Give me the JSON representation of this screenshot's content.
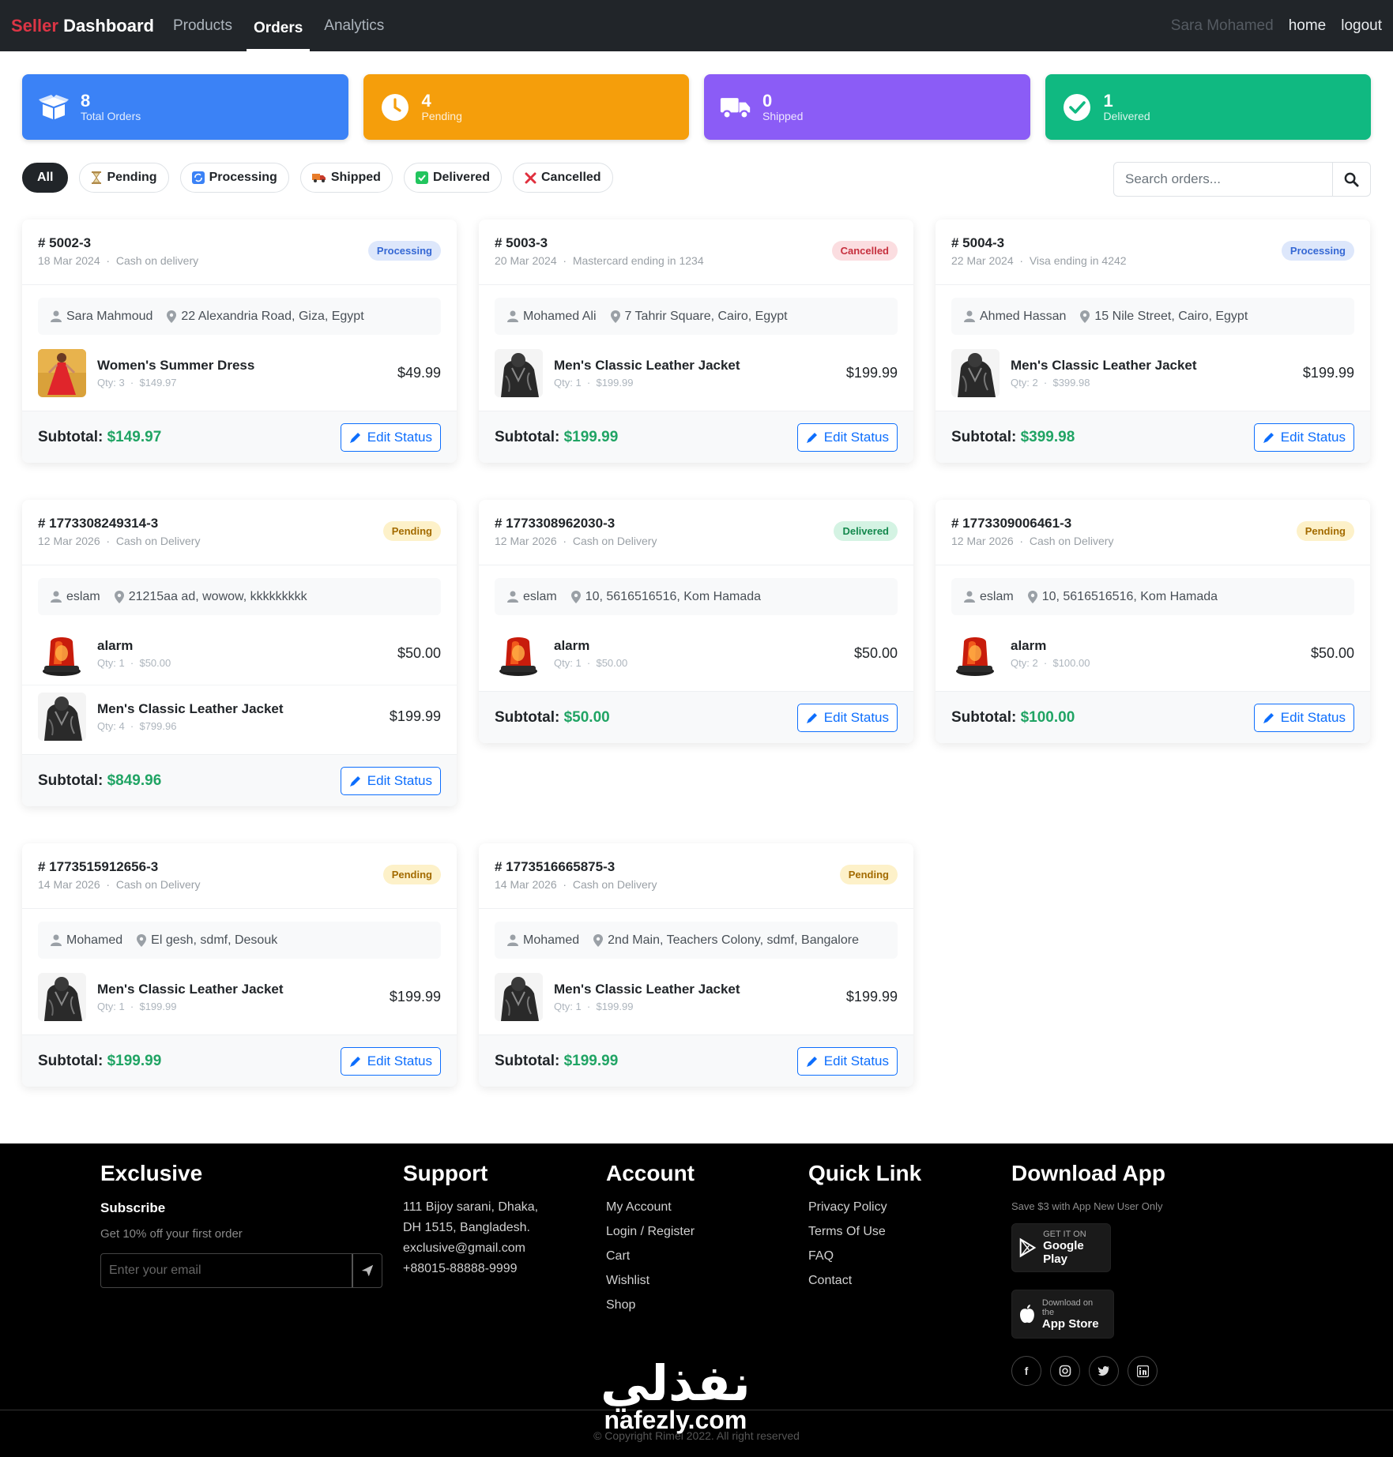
{
  "nav": {
    "brand_accent": "Seller",
    "brand_rest": "Dashboard",
    "links": [
      "Products",
      "Orders",
      "Analytics"
    ],
    "active": "Orders",
    "user": "Sara Mohamed",
    "home": "home",
    "logout": "logout"
  },
  "stats": [
    {
      "value": "8",
      "label": "Total Orders",
      "color": "#3b82f6",
      "icon": "box-open-icon"
    },
    {
      "value": "4",
      "label": "Pending",
      "color": "#f59e0b",
      "icon": "clock-icon"
    },
    {
      "value": "0",
      "label": "Shipped",
      "color": "#8b5cf6",
      "icon": "truck-icon"
    },
    {
      "value": "1",
      "label": "Delivered",
      "color": "#10b981",
      "icon": "check-circle-icon"
    }
  ],
  "filters": [
    {
      "label": "All",
      "icon": ""
    },
    {
      "label": "Pending",
      "icon": "hourglass-icon"
    },
    {
      "label": "Processing",
      "icon": "arrows-icon"
    },
    {
      "label": "Shipped",
      "icon": "truck-icon"
    },
    {
      "label": "Delivered",
      "icon": "check-box-icon"
    },
    {
      "label": "Cancelled",
      "icon": "cross-icon"
    }
  ],
  "search": {
    "placeholder": "Search orders..."
  },
  "orders": [
    {
      "id": "# 5002-3",
      "date": "18 Mar 2024",
      "payment": "Cash on delivery",
      "status": "Processing",
      "customer": "Sara Mahmoud",
      "address": "22 Alexandria Road, Giza, Egypt",
      "items": [
        {
          "name": "Women's Summer Dress",
          "qty": "Qty: 3",
          "unit": "$149.97",
          "price": "$49.99",
          "img": "dress"
        }
      ],
      "subtotal_label": "Subtotal:",
      "subtotal": "$149.97",
      "edit": "Edit Status"
    },
    {
      "id": "# 5003-3",
      "date": "20 Mar 2024",
      "payment": "Mastercard ending in 1234",
      "status": "Cancelled",
      "customer": "Mohamed Ali",
      "address": "7 Tahrir Square, Cairo, Egypt",
      "items": [
        {
          "name": "Men's Classic Leather Jacket",
          "qty": "Qty: 1",
          "unit": "$199.99",
          "price": "$199.99",
          "img": "jacket"
        }
      ],
      "subtotal_label": "Subtotal:",
      "subtotal": "$199.99",
      "edit": "Edit Status"
    },
    {
      "id": "# 5004-3",
      "date": "22 Mar 2024",
      "payment": "Visa ending in 4242",
      "status": "Processing",
      "customer": "Ahmed Hassan",
      "address": "15 Nile Street, Cairo, Egypt",
      "items": [
        {
          "name": "Men's Classic Leather Jacket",
          "qty": "Qty: 2",
          "unit": "$399.98",
          "price": "$199.99",
          "img": "jacket"
        }
      ],
      "subtotal_label": "Subtotal:",
      "subtotal": "$399.98",
      "edit": "Edit Status"
    },
    {
      "id": "# 1773308249314-3",
      "date": "12 Mar 2026",
      "payment": "Cash on Delivery",
      "status": "Pending",
      "customer": "eslam",
      "address": "21215aa ad, wowow, kkkkkkkkk",
      "items": [
        {
          "name": "alarm",
          "qty": "Qty: 1",
          "unit": "$50.00",
          "price": "$50.00",
          "img": "alarm"
        },
        {
          "name": "Men's Classic Leather Jacket",
          "qty": "Qty: 4",
          "unit": "$799.96",
          "price": "$199.99",
          "img": "jacket"
        }
      ],
      "subtotal_label": "Subtotal:",
      "subtotal": "$849.96",
      "edit": "Edit Status"
    },
    {
      "id": "# 1773308962030-3",
      "date": "12 Mar 2026",
      "payment": "Cash on Delivery",
      "status": "Delivered",
      "customer": "eslam",
      "address": "10, 5616516516, Kom Hamada",
      "items": [
        {
          "name": "alarm",
          "qty": "Qty: 1",
          "unit": "$50.00",
          "price": "$50.00",
          "img": "alarm"
        }
      ],
      "subtotal_label": "Subtotal:",
      "subtotal": "$50.00",
      "edit": "Edit Status"
    },
    {
      "id": "# 1773309006461-3",
      "date": "12 Mar 2026",
      "payment": "Cash on Delivery",
      "status": "Pending",
      "customer": "eslam",
      "address": "10, 5616516516, Kom Hamada",
      "items": [
        {
          "name": "alarm",
          "qty": "Qty: 2",
          "unit": "$100.00",
          "price": "$50.00",
          "img": "alarm"
        }
      ],
      "subtotal_label": "Subtotal:",
      "subtotal": "$100.00",
      "edit": "Edit Status"
    },
    {
      "id": "# 1773515912656-3",
      "date": "14 Mar 2026",
      "payment": "Cash on Delivery",
      "status": "Pending",
      "customer": "Mohamed",
      "address": "El gesh, sdmf, Desouk",
      "items": [
        {
          "name": "Men's Classic Leather Jacket",
          "qty": "Qty: 1",
          "unit": "$199.99",
          "price": "$199.99",
          "img": "jacket"
        }
      ],
      "subtotal_label": "Subtotal:",
      "subtotal": "$199.99",
      "edit": "Edit Status"
    },
    {
      "id": "# 1773516665875-3",
      "date": "14 Mar 2026",
      "payment": "Cash on Delivery",
      "status": "Pending",
      "customer": "Mohamed",
      "address": "2nd Main, Teachers Colony, sdmf, Bangalore",
      "items": [
        {
          "name": "Men's Classic Leather Jacket",
          "qty": "Qty: 1",
          "unit": "$199.99",
          "price": "$199.99",
          "img": "jacket"
        }
      ],
      "subtotal_label": "Subtotal:",
      "subtotal": "$199.99",
      "edit": "Edit Status"
    }
  ],
  "footer": {
    "exclusive": {
      "title": "Exclusive",
      "subscribe": "Subscribe",
      "offer": "Get 10% off your first order",
      "email_placeholder": "Enter your email"
    },
    "support": {
      "title": "Support",
      "lines": [
        "111 Bijoy sarani, Dhaka,",
        "DH 1515, Bangladesh.",
        "exclusive@gmail.com",
        "+88015-88888-9999"
      ]
    },
    "account": {
      "title": "Account",
      "links": [
        "My Account",
        "Login / Register",
        "Cart",
        "Wishlist",
        "Shop"
      ]
    },
    "quick": {
      "title": "Quick Link",
      "links": [
        "Privacy Policy",
        "Terms Of Use",
        "FAQ",
        "Contact"
      ]
    },
    "app": {
      "title": "Download App",
      "note": "Save $3 with App New User Only",
      "google_small": "GET IT ON",
      "google_big": "Google Play",
      "apple_small": "Download on the",
      "apple_big": "App Store"
    },
    "social": [
      "facebook-icon",
      "instagram-icon",
      "twitter-icon",
      "linkedin-icon"
    ],
    "copyright": "© Copyright Rimel 2022. All right reserved"
  },
  "watermark": {
    "arabic": "نفذلي",
    "latin": "nafezly.com"
  }
}
